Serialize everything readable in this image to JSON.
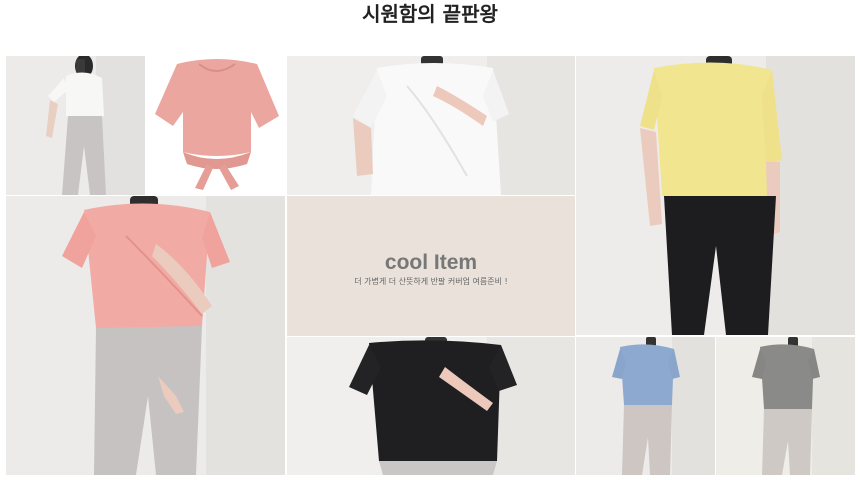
{
  "page": {
    "title": "시원함의 끝판왕"
  },
  "promo": {
    "heading": "cool Item",
    "subtitle": "더 가볍게 더 산뜻하게 반팔 커버업 여름준비 !"
  },
  "products": [
    {
      "name": "white-top-mirror-selfie",
      "shirt_color": "#f7f7f5"
    },
    {
      "name": "pink-wrap-top-flatlay",
      "shirt_color": "#eba79f"
    },
    {
      "name": "white-top-closeup",
      "shirt_color": "#f9f9f9"
    },
    {
      "name": "yellow-top-black-leggings",
      "shirt_color": "#f2e58f"
    },
    {
      "name": "pink-top-grey-leggings",
      "shirt_color": "#f2aaa4"
    },
    {
      "name": "black-top-closeup",
      "shirt_color": "#1f1f21"
    },
    {
      "name": "blue-top-grey-leggings",
      "shirt_color": "#8ea9cf"
    },
    {
      "name": "grey-top-grey-leggings",
      "shirt_color": "#8a8a88"
    }
  ]
}
